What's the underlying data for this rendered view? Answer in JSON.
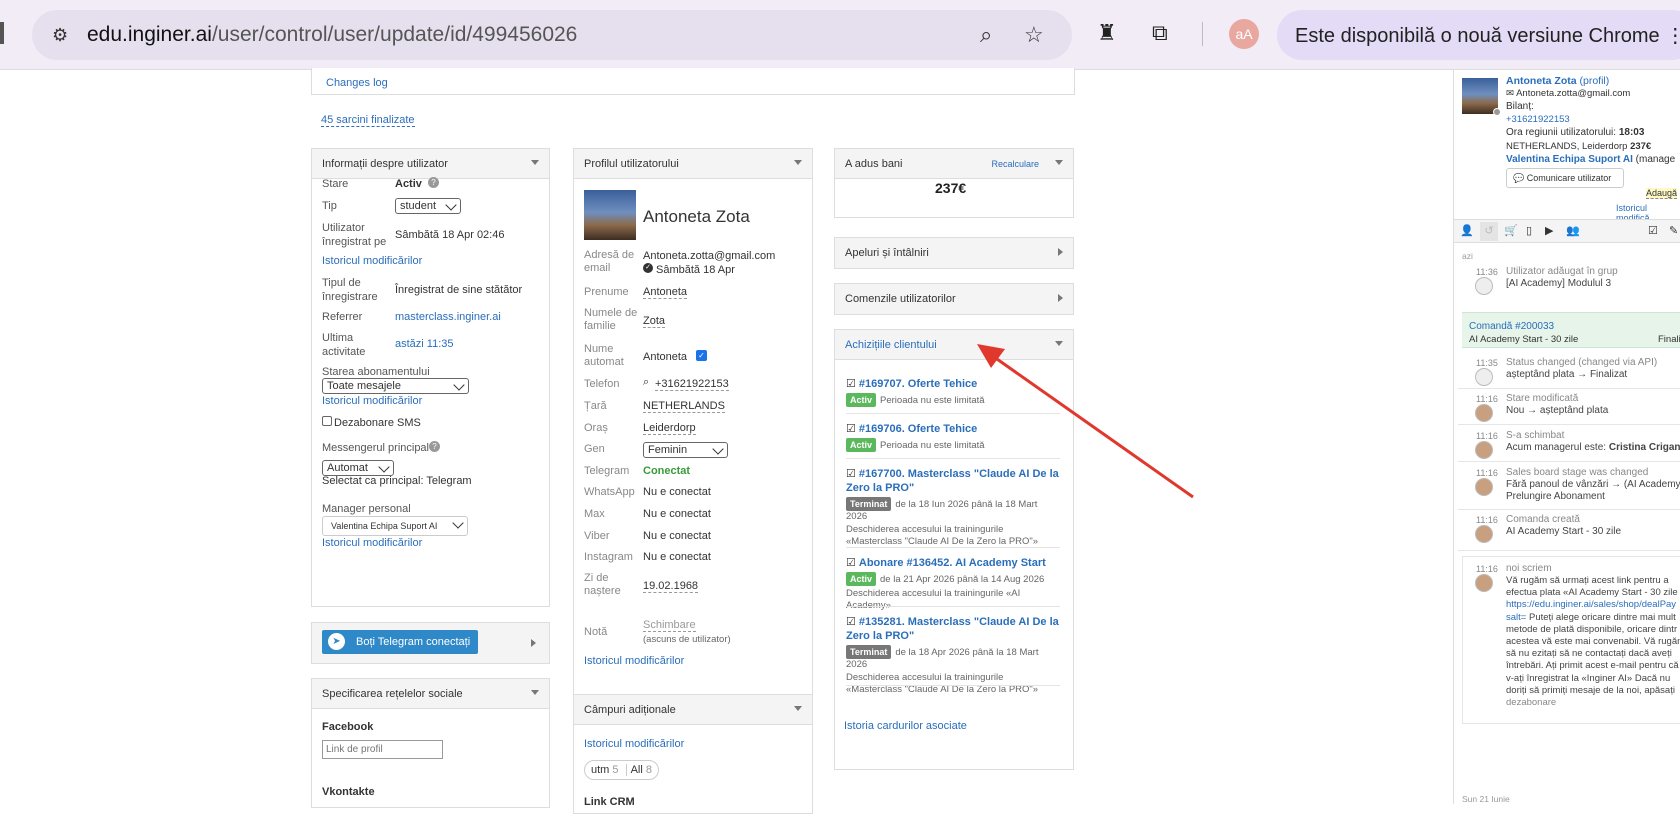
{
  "browser": {
    "url_domain": "edu.inginer.ai",
    "url_path": "/user/control/user/update/id/499456026",
    "profile_initials": "aA",
    "update_notice": "Este disponibilă o nouă versiune Chrome"
  },
  "top": {
    "changes_log": "Changes log",
    "tasks_done": "45 sarcini finalizate"
  },
  "user_info": {
    "title": "Informații despre utilizator",
    "status_label": "Stare",
    "status_value": "Activ",
    "type_label": "Tip",
    "type_value": "student",
    "registered_label": "Utilizator înregistrat pe",
    "registered_value": "Sâmbătă 18 Apr 02:46",
    "history1": "Istoricul modificărilor",
    "reg_type_label": "Tipul de înregistrare",
    "reg_type_value": "Înregistrat de sine stătător",
    "referrer_label": "Referrer",
    "referrer_value": "masterclass.inginer.ai",
    "last_activity_label": "Ultima activitate",
    "last_activity_value": "astăzi 11:35",
    "subscription_label": "Starea abonamentului",
    "subscription_value": "Toate mesajele",
    "history2": "Istoricul modificărilor",
    "sms_unsub": "Dezabonare SMS",
    "messenger_label": "Messengerul principal",
    "messenger_value": "Automat",
    "messenger_note": "Selectat ca principal: Telegram",
    "manager_label": "Manager personal",
    "manager_value": "Valentina Echipa Suport AI",
    "history3": "Istoricul modificărilor"
  },
  "telegram": {
    "button": "Boți Telegram conectați"
  },
  "social": {
    "title": "Specificarea rețelelor sociale",
    "facebook_label": "Facebook",
    "facebook_placeholder": "Link de profil",
    "vk_label": "Vkontakte"
  },
  "profile": {
    "title": "Profilul utilizatorului",
    "name": "Antoneta Zota",
    "email_label": "Adresă de email",
    "email_value": "Antoneta.zotta@gmail.com",
    "email_date": "Sâmbătă 18 Apr",
    "firstname_label": "Prenume",
    "firstname_value": "Antoneta",
    "lastname_label": "Numele de familie",
    "lastname_value": "Zota",
    "autoname_label": "Nume automat",
    "autoname_value": "Antoneta",
    "phone_label": "Telefon",
    "phone_value": "+31621922153",
    "country_label": "Țară",
    "country_value": "NETHERLANDS",
    "city_label": "Oraș",
    "city_value": "Leiderdorp",
    "gender_label": "Gen",
    "gender_value": "Feminin",
    "telegram_label": "Telegram",
    "telegram_value": "Conectat",
    "whatsapp_label": "WhatsApp",
    "whatsapp_value": "Nu e conectat",
    "max_label": "Max",
    "max_value": "Nu e conectat",
    "viber_label": "Viber",
    "viber_value": "Nu e conectat",
    "instagram_label": "Instagram",
    "instagram_value": "Nu e conectat",
    "birth_label": "Zi de naștere",
    "birth_value": "19.02.1968",
    "note_label": "Notă",
    "note_value": "Schimbare",
    "note_hint": "(ascuns de utilizator)",
    "history": "Istoricul modificărilor"
  },
  "extra_fields": {
    "title": "Câmpuri adiționale",
    "history": "Istoricul modificărilor",
    "tab1": "utm",
    "tab1_count": "5",
    "tab2": "All",
    "tab2_count": "8",
    "link_crm": "Link CRM"
  },
  "money": {
    "title": "A adus bani",
    "recalc": "Recalculare",
    "amount": "237€"
  },
  "calls": {
    "title": "Apeluri și întâlniri"
  },
  "orders": {
    "title": "Comenzile utilizatorilor"
  },
  "purchases": {
    "title": "Achizițiile clientului",
    "items": [
      {
        "name": "#169707. Oferte Tehice",
        "badge": "Activ",
        "info": "Perioada nu este limitată",
        "desc": ""
      },
      {
        "name": "#169706. Oferte Tehice",
        "badge": "Activ",
        "info": "Perioada nu este limitată",
        "desc": ""
      },
      {
        "name": "#167700. Masterclass \"Claude AI De la Zero la PRO\"",
        "badge": "Terminat",
        "info": "de la 18 Iun 2026 până la 18 Mart 2026",
        "desc": "Deschiderea accesului la trainingurile «Masterclass \"Claude AI De la Zero la PRO\"»"
      },
      {
        "name": "Abonare #136452. AI Academy Start",
        "badge": "Activ",
        "info": "de la 21 Apr 2026 până la 14 Aug 2026",
        "desc": "Deschiderea accesului la trainingurile «AI Academy»"
      },
      {
        "name": "#135281. Masterclass \"Claude AI De la Zero la PRO\"",
        "badge": "Terminat",
        "info": "de la 18 Apr 2026 până la 18 Mart 2026",
        "desc": "Deschiderea accesului la trainingurile «Masterclass \"Claude AI De la Zero la PRO\"»"
      }
    ]
  },
  "cards_history": "Istoria cardurilor asociate",
  "sidebar": {
    "name": "Antoneta Zota",
    "profile_link": "(profil)",
    "email": "Antoneta.zotta@gmail.com",
    "balance": "Bilanț:",
    "phone": "+31621922153",
    "region_time_label": "Ora regiunii utilizatorului:",
    "region_time": "18:03",
    "location": "NETHERLANDS, Leiderdorp",
    "location_amount": "237€",
    "manager": "Valentina Echipa Suport AI",
    "manager_suffix": "(manage",
    "contact_button": "Comunicare utilizator",
    "add_label": "Adaugă",
    "history": "Istoricul modifică",
    "today": "azi",
    "ev1_time": "11:36",
    "ev1_title": "Utilizator adăugat în grup",
    "ev1_text": "[AI Academy] Modulul 3",
    "order_title": "Comandă #200033",
    "order_sub": "AI Academy Start - 30 zile",
    "order_status": "Finali",
    "ev2_time": "11:35",
    "ev2_title": "Status changed (changed via API)",
    "ev2_text": "așteptând plata → Finalizat",
    "ev3_time": "11:16",
    "ev3_title": "Stare modificată",
    "ev3_text": "Nou → așteptând plata",
    "ev4_time": "11:16",
    "ev4_title": "S-a schimbat",
    "ev4_text_prefix": "Acum managerul este:",
    "ev4_text_bold": "Cristina Crigan",
    "ev5_time": "11:16",
    "ev5_title": "Sales board stage was changed",
    "ev5_text": "Fără panoul de vânzări → (AI Academy)",
    "ev5_text2": "Prelungire Abonament",
    "ev6_time": "11:16",
    "ev6_title": "Comanda creată",
    "ev6_text": "AI Academy Start - 30 zile",
    "ev7_time": "11:16",
    "ev7_title": "noi scriem",
    "ev7_l1": "Vă rugăm să urmați acest link pentru a",
    "ev7_l2": "efectua plata «AI Academy Start - 30 zile",
    "ev7_l3": "https://edu.inginer.ai/sales/shop/dealPay",
    "ev7_l4a": "salt=",
    "ev7_l4b": " Puteți alege oricare dintre mai mult",
    "ev7_l5": "metode de plată disponibile, oricare dintr",
    "ev7_l6": "acestea vă este mai convenabil. Vă rugăm",
    "ev7_l7": "să nu ezitați să ne contactați dacă aveți",
    "ev7_l8": "întrebări. Ați primit acest e-mail pentru că",
    "ev7_l9": "v-ați înregistrat la «Inginer AI» Dacă nu",
    "ev7_l10": "doriți să primiți mesaje de la noi, apăsați",
    "ev7_l11": "dezabonare",
    "footer_date": "Sun 21 Iunie"
  },
  "colors": {
    "accent": "#2a6ebb",
    "active_green": "#5cb85c",
    "telegram_blue": "#2f89c9",
    "arrow": "#e0382c",
    "order_bg": "#e6f4ea"
  }
}
